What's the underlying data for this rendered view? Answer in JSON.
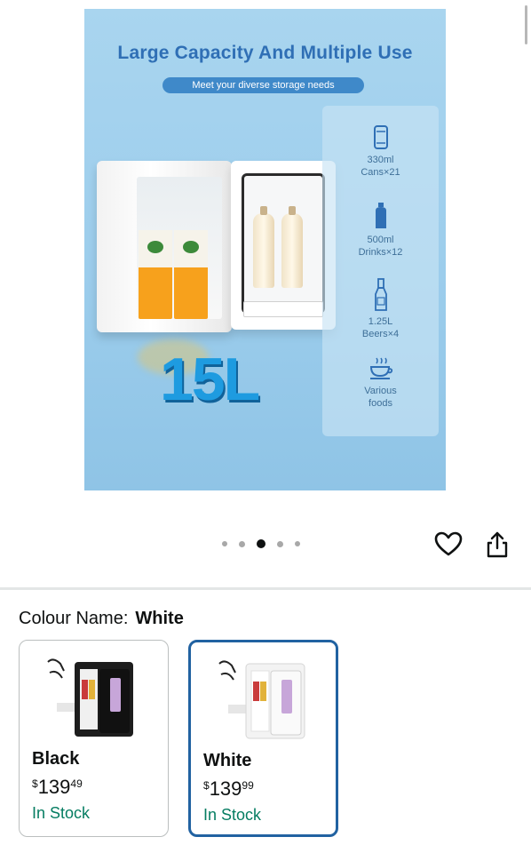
{
  "hero": {
    "title": "Large Capacity And Multiple Use",
    "subtitle": "Meet your diverse storage needs",
    "capacity": "15L",
    "features": [
      {
        "icon": "can-icon",
        "line1": "330ml",
        "line2": "Cans×21"
      },
      {
        "icon": "water-bottle-icon",
        "line1": "500ml",
        "line2": "Drinks×12"
      },
      {
        "icon": "beer-bottle-icon",
        "line1": "1.25L",
        "line2": "Beers×4"
      },
      {
        "icon": "hot-food-icon",
        "line1": "Various",
        "line2": "foods"
      }
    ]
  },
  "carousel": {
    "dot_count": 5,
    "active_index": 2
  },
  "actions": {
    "favorite_icon": "heart-icon",
    "share_icon": "share-icon"
  },
  "variant": {
    "label": "Colour Name:",
    "selected": "White"
  },
  "swatches": [
    {
      "name": "Black",
      "currency": "$",
      "price_whole": "139",
      "price_fraction": "49",
      "stock": "In Stock",
      "selected": false
    },
    {
      "name": "White",
      "currency": "$",
      "price_whole": "139",
      "price_fraction": "99",
      "stock": "In Stock",
      "selected": true
    }
  ],
  "colors": {
    "accent_blue": "#2162a1",
    "in_stock_green": "#067d62",
    "hero_title_blue": "#2f6fb5"
  }
}
